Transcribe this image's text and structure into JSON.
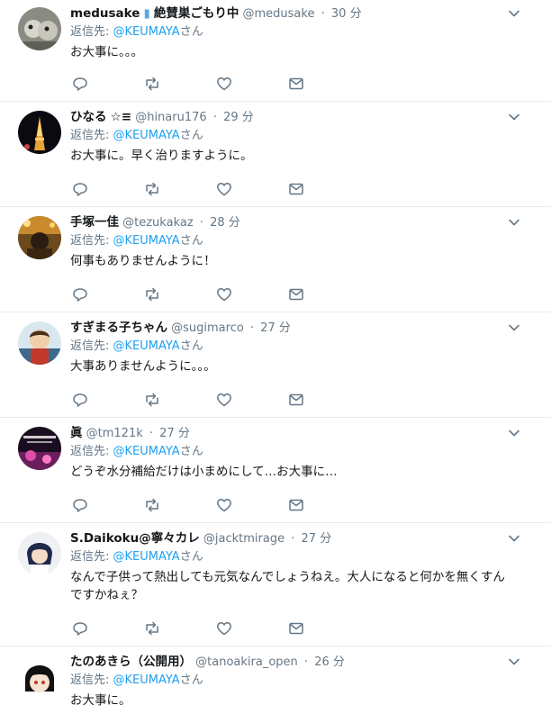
{
  "reply_prefix": "返信先: ",
  "tweets": [
    {
      "name": "medusake",
      "badge": "絶賛巣ごもり中",
      "screen": "@medusake",
      "time": "30 分",
      "mention": "@KEUMAYA",
      "mention_suffix": "さん",
      "text": "お大事に。。。"
    },
    {
      "name": "ひなる",
      "badge": "☆≡",
      "screen": "@hinaru176",
      "time": "29 分",
      "mention": "@KEUMAYA",
      "mention_suffix": "さん",
      "text": "お大事に。早く治りますように。"
    },
    {
      "name": "手塚一佳",
      "badge": "",
      "screen": "@tezukakaz",
      "time": "28 分",
      "mention": "@KEUMAYA",
      "mention_suffix": "さん",
      "text": "何事もありませんように！"
    },
    {
      "name": "すぎまる子ちゃん",
      "badge": "",
      "screen": "@sugimarco",
      "time": "27 分",
      "mention": "@KEUMAYA",
      "mention_suffix": "さん",
      "text": "大事ありませんように。。。"
    },
    {
      "name": "眞",
      "badge": "",
      "screen": "@tm121k",
      "time": "27 分",
      "mention": "@KEUMAYA",
      "mention_suffix": "さん",
      "text": "どうぞ水分補給だけは小まめにして…お大事に…"
    },
    {
      "name": "S.Daikoku@寧々カレ",
      "badge": "",
      "screen": "@jacktmirage",
      "time": "27 分",
      "mention": "@KEUMAYA",
      "mention_suffix": "さん",
      "text": "なんで子供って熱出しても元気なんでしょうねえ。大人になると何かを無くすんですかねぇ？"
    },
    {
      "name": "たのあきら（公開用）",
      "badge": "",
      "screen": "@tanoakira_open",
      "time": "26 分",
      "mention": "@KEUMAYA",
      "mention_suffix": "さん",
      "text": "お大事に。"
    }
  ]
}
